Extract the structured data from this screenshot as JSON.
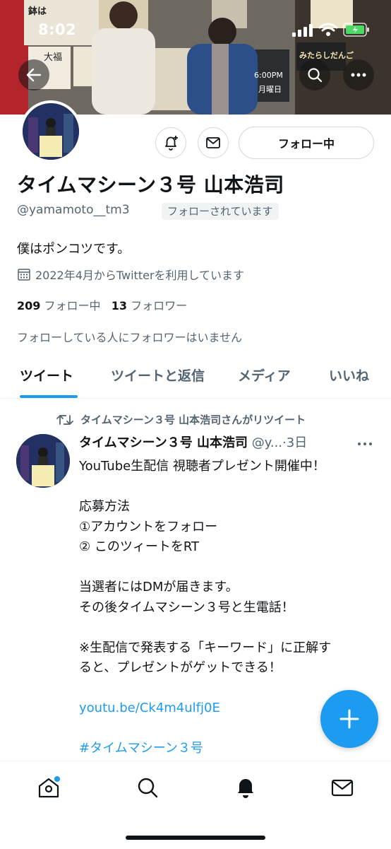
{
  "status_bar": {
    "time": "8:02"
  },
  "profile": {
    "display_name": "タイムマシーン３号 山本浩司",
    "handle": "@yamamoto__tm3",
    "follows_you_badge": "フォローされています",
    "follow_button_label": "フォロー中",
    "bio": "僕はポンコツです。",
    "joined": "2022年4月からTwitterを利用しています",
    "following_count": "209",
    "following_label": "フォロー中",
    "followers_count": "13",
    "followers_label": "フォロワー",
    "mutuals_text": "フォローしている人にフォロワーはいません"
  },
  "tabs": [
    {
      "label": "ツイート",
      "active": true
    },
    {
      "label": "ツイートと返信",
      "active": false
    },
    {
      "label": "メディア",
      "active": false
    },
    {
      "label": "いいね",
      "active": false
    }
  ],
  "tweet": {
    "retweet_context": "タイムマシーン３号 山本浩司さんがリツイート",
    "author_name": "タイムマシーン３号 山本浩司",
    "author_handle_truncated": "@y...",
    "separator": "·",
    "time": "3日",
    "lines": [
      "YouTube生配信 視聴者プレゼント開催中！",
      "",
      "応募方法",
      "①アカウントをフォロー",
      "② このツィートをRT",
      "",
      "当選者にはDMが届きます。",
      "その後タイムマシーン３号と生電話！",
      "",
      "※生配信で発表する「キーワード」に正解す",
      "ると、プレゼントがゲットできる！",
      ""
    ],
    "link": "youtu.be/Ck4m4ulfj0E",
    "hashtag": "#タイムマシーン３号"
  },
  "banner_signs": {
    "sign_a": "鉢は",
    "sign_b": "大福",
    "sign_c": "6:00PM",
    "sign_d": "月曜日",
    "sign_e": "みたらしだんご"
  },
  "colors": {
    "accent": "#1d9bf0",
    "text_primary": "#0f1419",
    "text_secondary": "#536471",
    "border": "#cfd9de"
  },
  "icons": {
    "back": "arrow-left-icon",
    "search": "search-icon",
    "more": "more-horizontal-icon",
    "notify": "bell-plus-icon",
    "message": "envelope-icon",
    "calendar": "calendar-icon",
    "retweet": "retweet-icon",
    "compose": "plus-icon",
    "nav": [
      "home-icon",
      "search-icon",
      "bell-icon",
      "envelope-icon"
    ]
  }
}
